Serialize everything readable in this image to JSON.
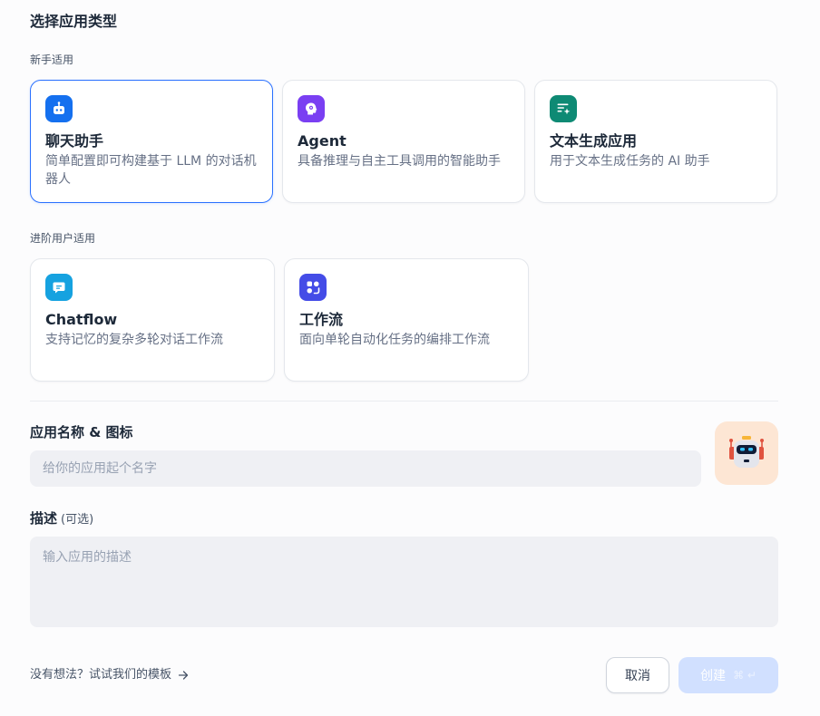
{
  "heading": "选择应用类型",
  "sections": {
    "beginner": "新手适用",
    "advanced": "进阶用户适用"
  },
  "cards": {
    "chat": {
      "title": "聊天助手",
      "desc": "简单配置即可构建基于 LLM 的对话机器人",
      "color": "#1570ef",
      "icon": "chat-bot-icon",
      "selected": true
    },
    "agent": {
      "title": "Agent",
      "desc": "具备推理与自主工具调用的智能助手",
      "color": "#7a3ff2",
      "icon": "agent-brain-icon"
    },
    "text": {
      "title": "文本生成应用",
      "desc": "用于文本生成任务的 AI 助手",
      "color": "#0e8a74",
      "icon": "text-generation-icon"
    },
    "chatflow": {
      "title": "Chatflow",
      "desc": "支持记忆的复杂多轮对话工作流",
      "color": "#16a2e0",
      "icon": "chatflow-icon"
    },
    "workflow": {
      "title": "工作流",
      "desc": "面向单轮自动化任务的编排工作流",
      "color": "#444ce7",
      "icon": "workflow-icon"
    }
  },
  "form": {
    "name_label": "应用名称 & 图标",
    "name_placeholder": "给你的应用起个名字",
    "name_value": "",
    "avatar_icon": "robot-avatar-icon",
    "desc_label": "描述",
    "desc_optional": "(可选)",
    "desc_placeholder": "输入应用的描述",
    "desc_value": ""
  },
  "footer": {
    "template_link": "没有想法？试试我们的模板",
    "cancel": "取消",
    "create": "创建",
    "create_shortcut": "⌘ ↵"
  }
}
